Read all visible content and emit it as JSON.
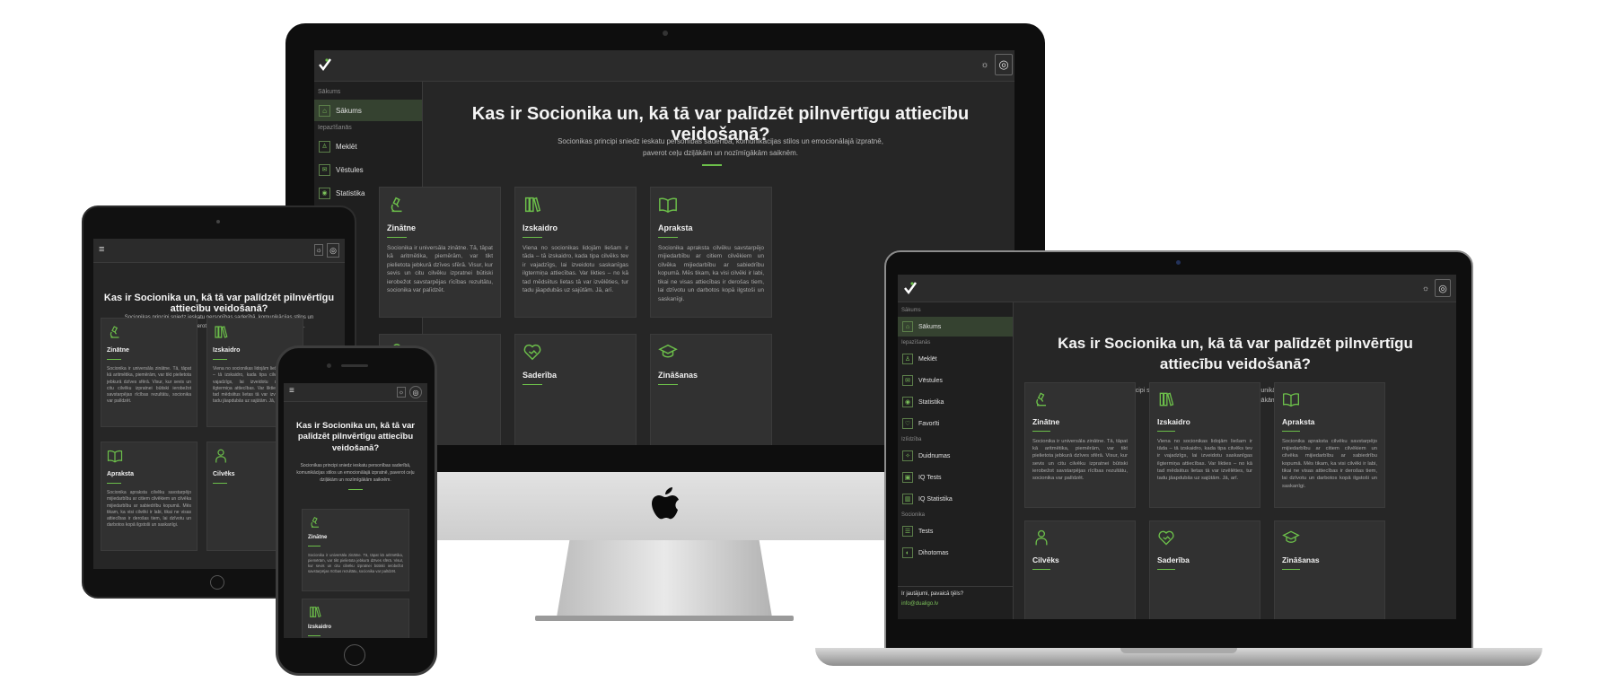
{
  "page": {
    "heading": "Kas ir Socionika un, kā tā var palīdzēt pilnvērtīgu attiecību veidošanā?",
    "subheading_line1": "Socionikas principi sniedz ieskatu personības saderībā, komunikācijas stilos un emocionālajā izpratnē,",
    "subheading_line2": "paverot ceļu dziļākām un nozīmīgākām saiknēm.",
    "subheading_full": "Socionikas principi sniedz ieskatu personības saderībā, komunikācijas stilos un emocionālajā izpratnē, paverot ceļu dziļākām un nozīmīgākām saiknēm."
  },
  "sidebar": {
    "sec_home": "Sākums",
    "sec_learn": "Iepazīšanās",
    "sec_tests": "Izlīdzība",
    "sec_socionics": "Socionika",
    "items": {
      "sakums": "Sākums",
      "mekleet": "Meklēt",
      "vestules": "Vēstules",
      "statistika": "Statistika",
      "favoriti": "Favorīti",
      "duidnumas": "Duidnumas",
      "iq_tests": "IQ Tests",
      "iq_stat": "IQ Statistika",
      "tests": "Tests",
      "dihotomas": "Dihotomas"
    },
    "footer_q": "Ir jautājumi, pavaicā tjēls?",
    "footer_mail": "info@dualigo.lv"
  },
  "cards": [
    {
      "icon": "microscope-icon",
      "title": "Zinātne",
      "text": "Socionika ir universāla zinātne. Tā, tāpat kā aritmētika, piemērām, var tikt pielietota jebkurā dzīves sfērā. Visur, kur sevis un citu cilvēku izpratnei būtiski ierobežot savstarpējas rīcības rezultātu, socionika var palīdzēt."
    },
    {
      "icon": "books-icon",
      "title": "Izskaidro",
      "text": "Viena no socionikas lidojām liešam ir tāda – tā izskaidro, kada tipa cilvēks tev ir vajadzīgs, lai izveidotu saskanīgas ilgtermiņa attiecības. Var likties – no kā tad mēdsiitus lietas tā var izvēlēties, tur tadu jāapdubās uz sajūtām. Jā, arī."
    },
    {
      "icon": "open-book-icon",
      "title": "Apraksta",
      "text": "Socionika apraksta cilvēku savstarpējo mijiedarbību ar citiem cilvēkiem un cilvēka mijiedarbību ar sabiedrību kopumā. Mēs tikam, ka visi cilvēki ir labi, tikai ne visas attiecības ir derošas tiem, lai dzīvotu un darbotos kopā ilgstoši un saskanīgi."
    },
    {
      "icon": "person-icon",
      "title": "Cilvēks",
      "text": ""
    },
    {
      "icon": "heart-handshake-icon",
      "title": "Saderība",
      "text": ""
    },
    {
      "icon": "graduation-cap-icon",
      "title": "Zināšanas",
      "text": ""
    }
  ],
  "colors": {
    "accent": "#6cbf4a",
    "bg": "#262626",
    "card": "#313131"
  }
}
